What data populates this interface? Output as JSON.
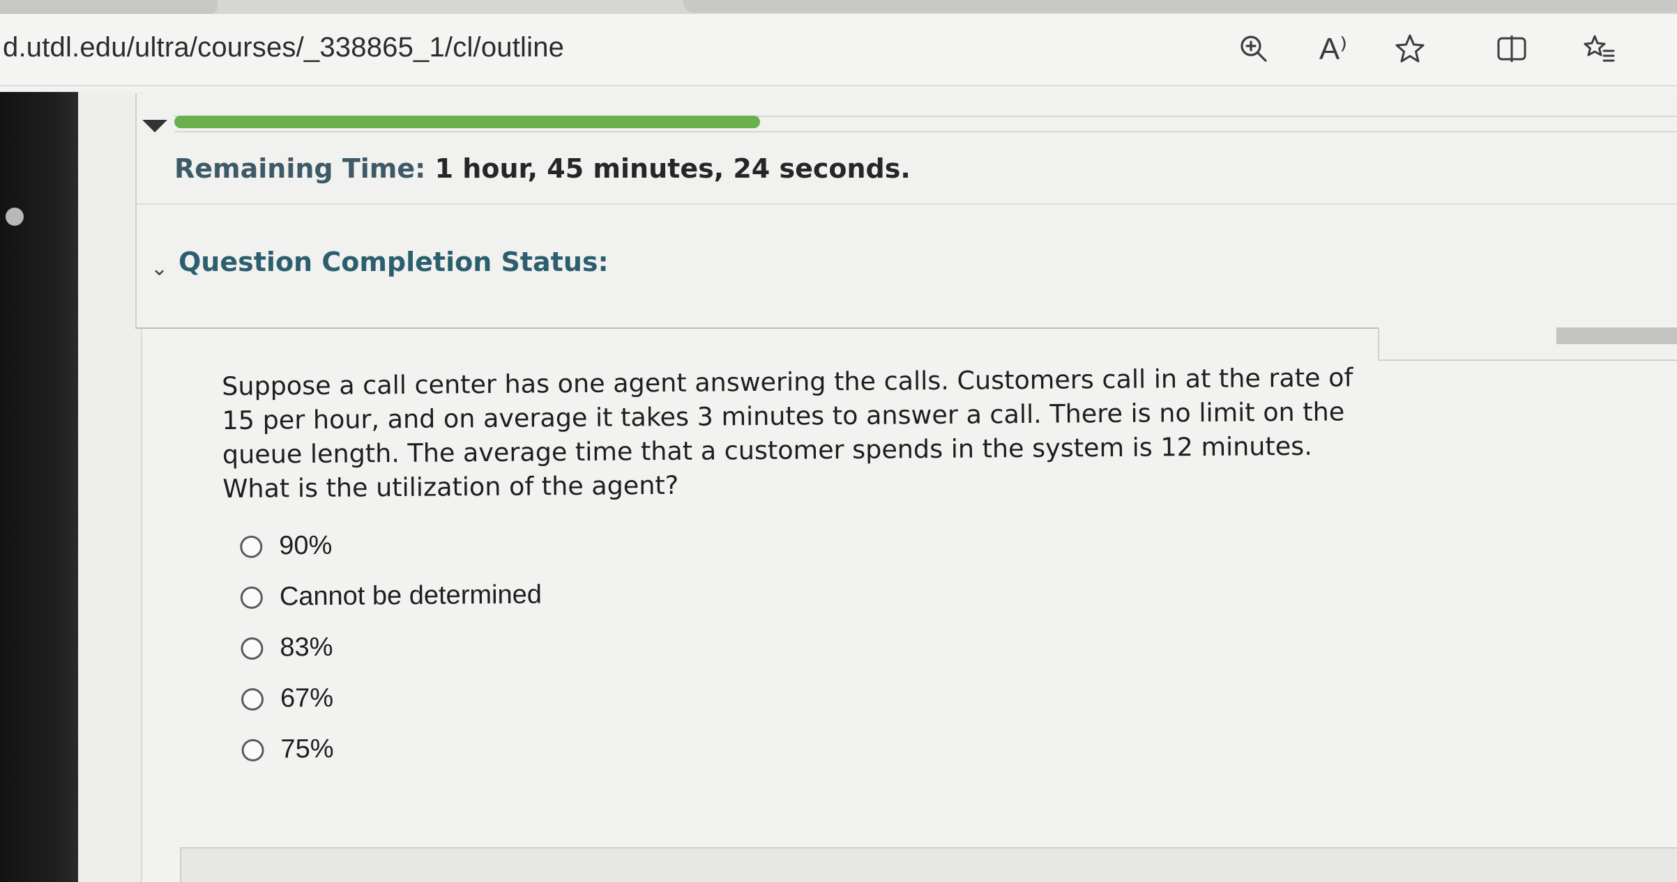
{
  "browser": {
    "url": "d.utdl.edu/ultra/courses/_338865_1/cl/outline",
    "icons": [
      "zoom-in-icon",
      "read-aloud-icon",
      "favorite-star-icon",
      "split-screen-icon",
      "favorites-list-icon"
    ],
    "read_aloud_glyph": "A⁾"
  },
  "test_header": {
    "progress_fraction": 0.39,
    "progress_color": "#6ab04c",
    "remaining_time_label": "Remaining Time:",
    "remaining_time_value": "1 hour, 45 minutes, 24 seconds.",
    "completion_status_label": "Question Completion Status:"
  },
  "question": {
    "text": "Suppose a call center has one agent answering the calls. Customers call in at the rate of 15 per hour, and on average it takes 3 minutes to answer a call. There is no limit on the queue length. The average time that a customer spends in the system is 12 minutes. What is the utilization of the agent?",
    "options": [
      {
        "label": "90%"
      },
      {
        "label": "Cannot be determined"
      },
      {
        "label": "83%"
      },
      {
        "label": "67%"
      },
      {
        "label": "75%"
      }
    ]
  }
}
